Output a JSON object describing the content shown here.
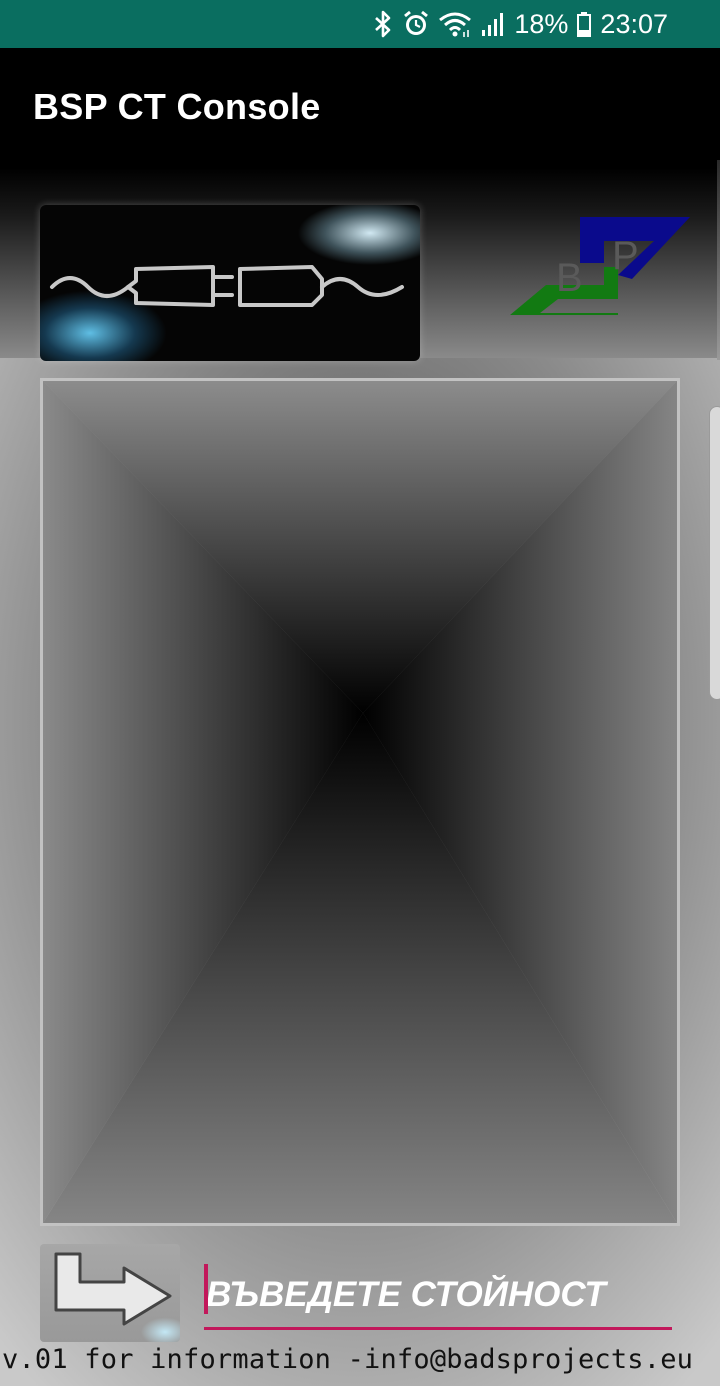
{
  "status_bar": {
    "battery_percent": "18%",
    "time": "23:07",
    "icons": [
      "bluetooth-icon",
      "alarm-icon",
      "wifi-icon",
      "signal-icon",
      "battery-icon"
    ],
    "color": "#0a6e60"
  },
  "app_bar": {
    "title": "BSP CT Console"
  },
  "header": {
    "connect_button_icon": "plug-connector-icon",
    "logo": {
      "letters": [
        "B",
        "P"
      ],
      "colors": {
        "blue": "#0a0a8c",
        "green": "#127a12"
      }
    }
  },
  "console": {
    "output_text": ""
  },
  "input_row": {
    "send_button_icon": "turn-right-arrow-icon",
    "placeholder": "ВЪВЕДЕТЕ СТОЙНОСТ",
    "value": "",
    "accent_color": "#c2185b"
  },
  "footer": {
    "text": "v.01 for information -info@badsprojects.eu"
  }
}
